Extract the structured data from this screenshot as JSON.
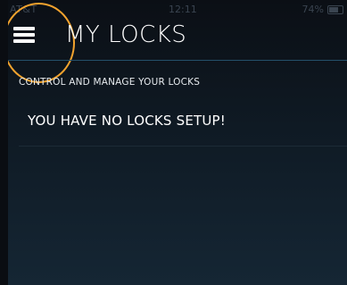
{
  "status_bar": {
    "carrier": "AT&T",
    "time": "12:11",
    "battery": "74%"
  },
  "header": {
    "title": "MY LOCKS",
    "menu_icon": "hamburger-menu-icon",
    "highlight_color": "#f2a32e"
  },
  "main": {
    "subtitle": "CONTROL AND MANAGE YOUR LOCKS",
    "empty_message": "YOU HAVE NO LOCKS SETUP!"
  }
}
